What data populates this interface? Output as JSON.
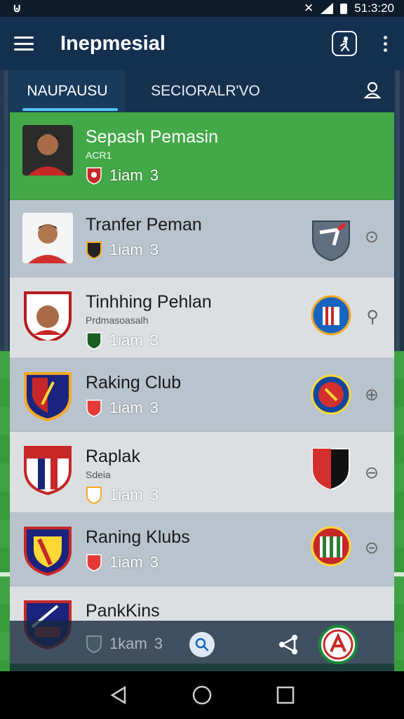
{
  "status_bar": {
    "left_icon": "notification-icon",
    "time": "51:3:20"
  },
  "app_bar": {
    "title": "Inepmesial",
    "menu_icon": "menu-icon",
    "profile_icon": "player-profile-icon",
    "more_icon": "more-vertical-icon"
  },
  "tabs": [
    {
      "label": "NAUPAUSU",
      "active": true
    },
    {
      "label": "SECIORALR'VO",
      "active": false
    }
  ],
  "list": [
    {
      "title": "Sepash Pemasin",
      "subtitle": "ACR1",
      "meta": "1iam",
      "count": "3",
      "highlight": true,
      "crest": "",
      "side": ""
    },
    {
      "title": "Tranfer Peman",
      "subtitle": "",
      "meta": "1iam",
      "count": "3",
      "highlight": false,
      "crest": "shield-crest",
      "side": "☺"
    },
    {
      "title": "Tinhhing Pehlan",
      "subtitle": "Prdmasoasalh",
      "meta": "1iam",
      "count": "3",
      "highlight": false,
      "crest": "round-crest",
      "side": "5"
    },
    {
      "title": "Raking Club",
      "subtitle": "",
      "meta": "1iam",
      "count": "3",
      "highlight": false,
      "crest": "round-crest-red",
      "side": "⊕"
    },
    {
      "title": "Raplak",
      "subtitle": "Sdeia",
      "meta": "1iam",
      "count": "3",
      "highlight": false,
      "crest": "shield-crest-black",
      "side": "⊖"
    },
    {
      "title": "Raning Klubs",
      "subtitle": "",
      "meta": "1iam",
      "count": "3",
      "highlight": false,
      "crest": "green-crest",
      "side": "⊝"
    },
    {
      "title": "PankKins",
      "subtitle": "",
      "meta": "1kam",
      "count": "3",
      "highlight": false,
      "crest": "",
      "side": ""
    }
  ],
  "colors": {
    "highlight": "#43a847",
    "row_light": "#dcdfe2",
    "row_dark": "#b9c3cd",
    "app_bar": "#14304f"
  }
}
